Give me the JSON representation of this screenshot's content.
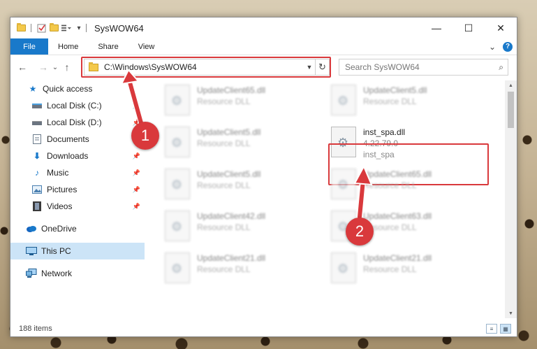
{
  "window": {
    "title": "SysWOW64",
    "minimize_glyph": "—",
    "maximize_glyph": "☐",
    "close_glyph": "✕"
  },
  "ribbon": {
    "tabs": [
      "File",
      "Home",
      "Share",
      "View"
    ],
    "expand_glyph": "⌄",
    "help_glyph": "?"
  },
  "nav": {
    "back_glyph": "←",
    "forward_glyph": "→",
    "recent_glyph": "⌄",
    "up_glyph": "↑",
    "address": "C:\\Windows\\SysWOW64",
    "search_placeholder": "Search SysWOW64"
  },
  "sidebar": {
    "items": [
      {
        "label": "Quick access",
        "icon": "star-icon",
        "pinned": false
      },
      {
        "label": "Local Disk (C:)",
        "icon": "drive-icon",
        "pinned": true
      },
      {
        "label": "Local Disk (D:)",
        "icon": "drive-icon",
        "pinned": true
      },
      {
        "label": "Documents",
        "icon": "documents-icon",
        "pinned": true
      },
      {
        "label": "Downloads",
        "icon": "download-icon",
        "pinned": true
      },
      {
        "label": "Music",
        "icon": "music-icon",
        "pinned": true
      },
      {
        "label": "Pictures",
        "icon": "pictures-icon",
        "pinned": true
      },
      {
        "label": "Videos",
        "icon": "videos-icon",
        "pinned": true
      },
      {
        "label": "OneDrive",
        "icon": "cloud-icon",
        "pinned": false
      },
      {
        "label": "This PC",
        "icon": "computer-icon",
        "pinned": false
      },
      {
        "label": "Network",
        "icon": "network-icon",
        "pinned": false
      }
    ]
  },
  "files": [
    {
      "name": "UpdateClient65.dll",
      "sub": "Resource DLL"
    },
    {
      "name": "UpdateClient5.dll",
      "sub": "Resource DLL"
    },
    {
      "name": "UpdateClient5.dll",
      "sub": "Resource DLL"
    },
    {
      "name": "inst_spa.dll",
      "version": "4.22.79.0",
      "sub": "inst_spa"
    },
    {
      "name": "UpdateClient5.dll",
      "sub": "Resource DLL"
    },
    {
      "name": "UpdateClient65.dll",
      "sub": "Resource DLL"
    },
    {
      "name": "UpdateClient42.dll",
      "sub": "Resource DLL"
    },
    {
      "name": "UpdateClient63.dll",
      "sub": "Resource DLL"
    },
    {
      "name": "UpdateClient21.dll",
      "sub": "Resource DLL"
    },
    {
      "name": "UpdateClient21.dll",
      "sub": "Resource DLL"
    }
  ],
  "status": {
    "item_count": "188 items"
  },
  "annotations": {
    "badge_1": "1",
    "badge_2": "2",
    "color": "#d9393c"
  }
}
